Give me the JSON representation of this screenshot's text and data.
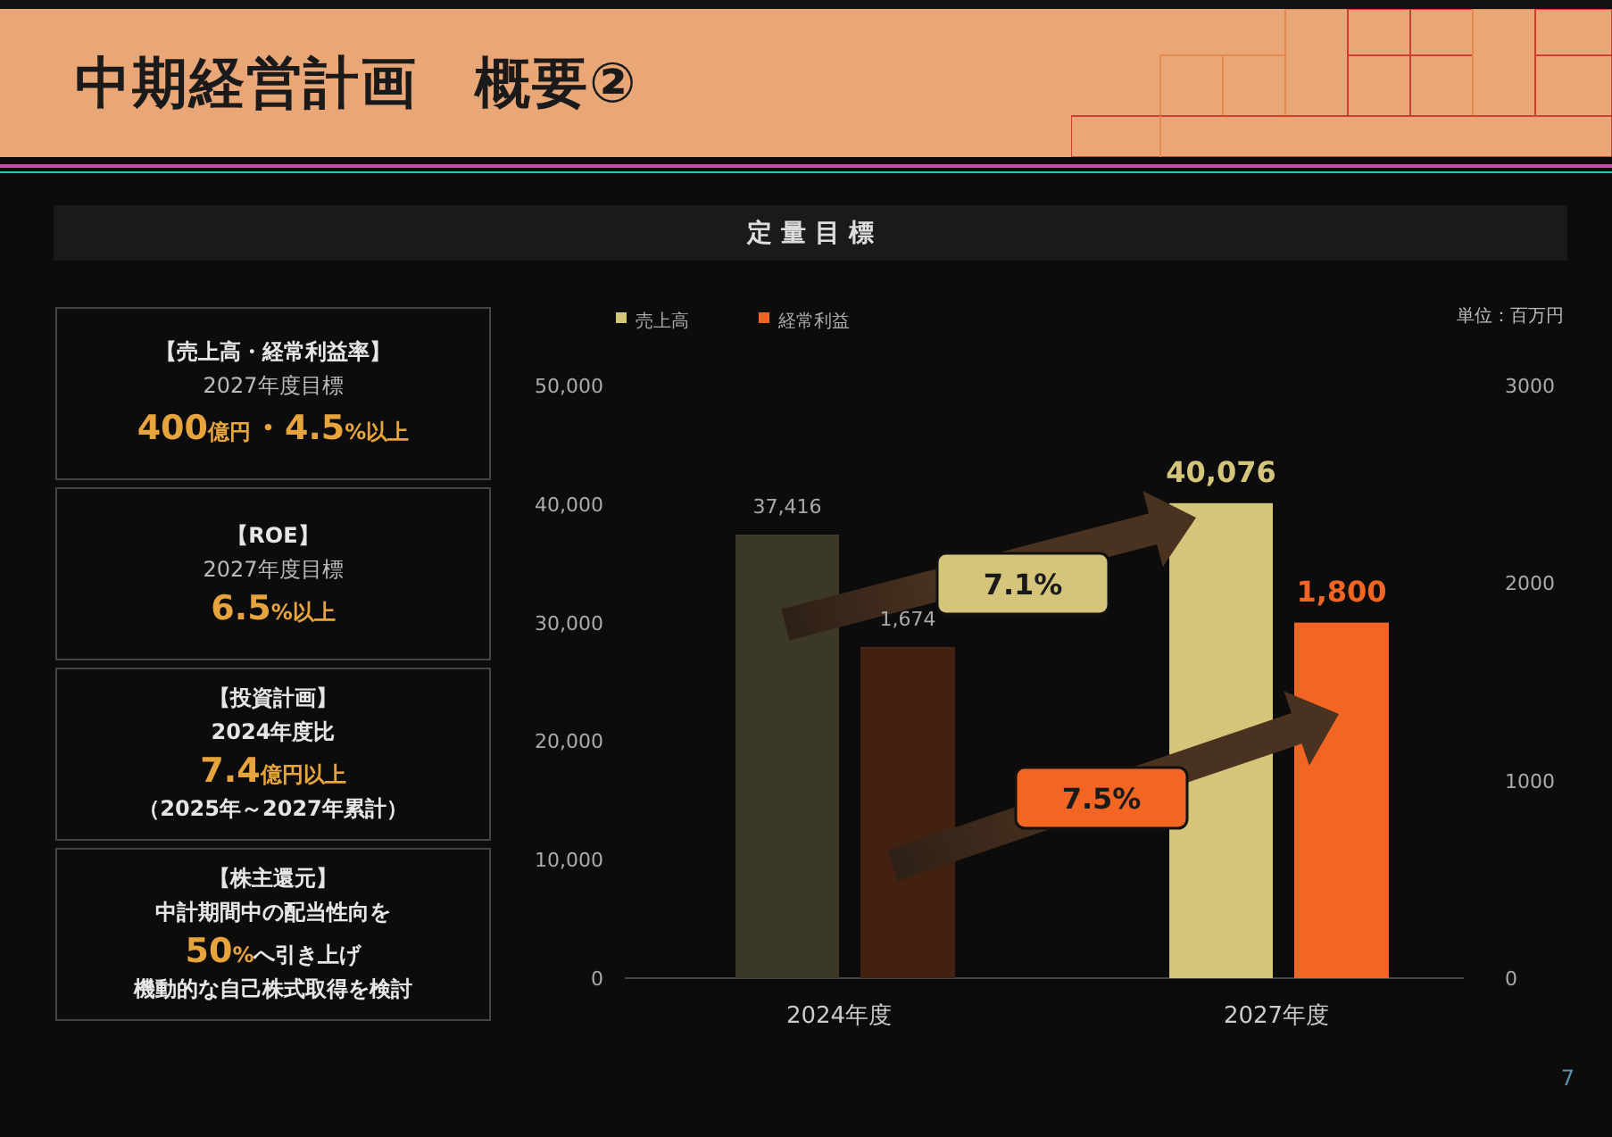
{
  "header": {
    "title": "中期経営計画　概要②"
  },
  "section": {
    "title": "定 量 目 標"
  },
  "cards": [
    {
      "lines": [
        {
          "kind": "heading",
          "text": "【売上高・経常利益率】"
        },
        {
          "kind": "note",
          "text": "2027年度目標"
        },
        {
          "kind": "value",
          "parts": [
            {
              "kind": "number",
              "text": "400"
            },
            {
              "kind": "unit",
              "text": "億円"
            },
            {
              "kind": "number",
              "text": "・4.5"
            },
            {
              "kind": "unit",
              "text": "%以上"
            }
          ]
        }
      ]
    },
    {
      "lines": [
        {
          "kind": "heading",
          "text": "【ROE】"
        },
        {
          "kind": "note",
          "text": "2027年度目標"
        },
        {
          "kind": "value",
          "parts": [
            {
              "kind": "number",
              "text": "6.5"
            },
            {
              "kind": "unit",
              "text": "%以上"
            }
          ]
        }
      ]
    },
    {
      "lines": [
        {
          "kind": "heading",
          "text": "【投資計画】"
        },
        {
          "kind": "heading",
          "text": "2024年度比"
        },
        {
          "kind": "value",
          "parts": [
            {
              "kind": "number",
              "text": "7.4"
            },
            {
              "kind": "unit",
              "text": "億円以上"
            }
          ]
        },
        {
          "kind": "heading",
          "text": "（2025年～2027年累計）"
        }
      ]
    },
    {
      "lines": [
        {
          "kind": "heading",
          "text": "【株主還元】"
        },
        {
          "kind": "heading",
          "text": "中計期間中の配当性向を"
        },
        {
          "kind": "value",
          "parts": [
            {
              "kind": "number",
              "text": "50"
            },
            {
              "kind": "unit",
              "text": "%"
            },
            {
              "kind": "heading",
              "text": "へ引き上げ"
            }
          ]
        },
        {
          "kind": "heading",
          "text": "機動的な自己株式取得を検討"
        }
      ]
    }
  ],
  "chart": {
    "unit": "単位：百万円",
    "chart_data": {
      "type": "bar",
      "categories": [
        "2024年度",
        "2027年度"
      ],
      "series": [
        {
          "name": "売上高",
          "color": "#d4c57a",
          "values": [
            37416,
            40076
          ],
          "value_labels": [
            "37,416",
            "40,076"
          ]
        },
        {
          "name": "経常利益",
          "color": "#f26522",
          "values": [
            1674,
            1800
          ],
          "value_labels": [
            "1,674",
            "1,800"
          ],
          "axis": "y2"
        }
      ],
      "stacked": false,
      "legend": "top",
      "ylim": [
        0,
        50000
      ],
      "yticks": [
        {
          "value": 0,
          "label": "0"
        },
        {
          "value": 10000,
          "label": "10,000"
        },
        {
          "value": 20000,
          "label": "20,000"
        },
        {
          "value": 30000,
          "label": "30,000"
        },
        {
          "value": 40000,
          "label": "40,000"
        },
        {
          "value": 50000,
          "label": "50,000"
        }
      ],
      "y2lim": [
        0,
        3000
      ],
      "y2ticks": [
        {
          "value": 0,
          "label": "0"
        },
        {
          "value": 1000,
          "label": "1000"
        },
        {
          "value": 2000,
          "label": "2000"
        },
        {
          "value": 3000,
          "label": "3000"
        }
      ],
      "data_labels": true,
      "annotations": [
        {
          "text": "7.1%"
        },
        {
          "text": "7.5%"
        }
      ]
    },
    "highlighted": [
      false,
      true
    ]
  },
  "page_number": "7"
}
